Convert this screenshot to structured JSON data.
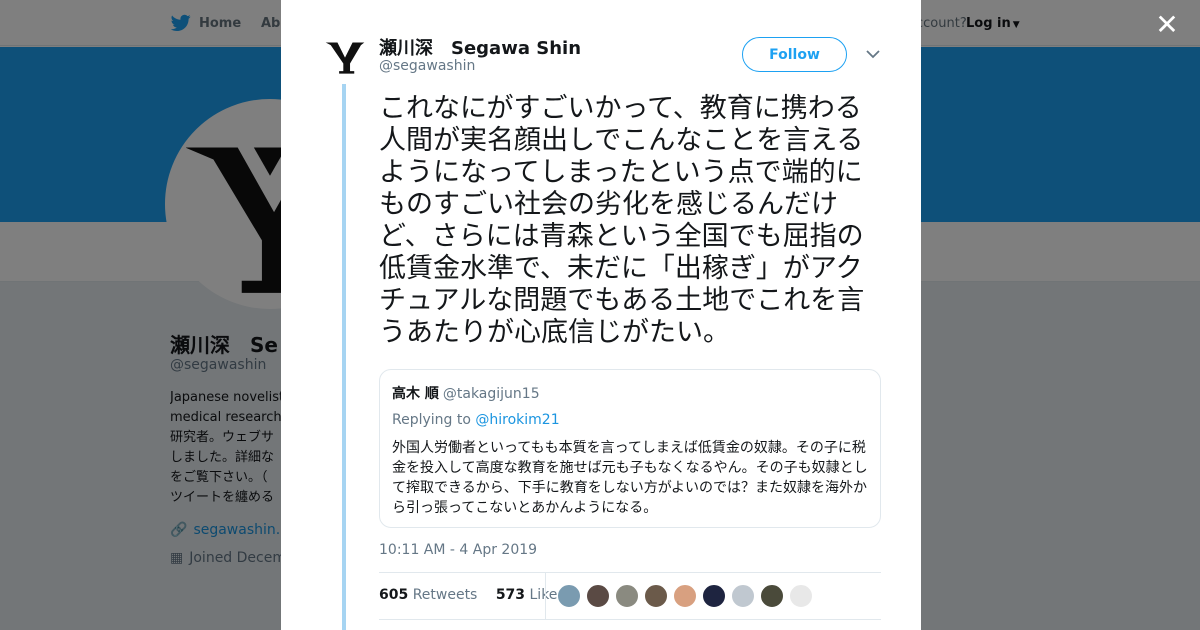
{
  "nav": {
    "home": "Home",
    "about": "Abo",
    "account_prompt": "ccount?",
    "login": "Log in"
  },
  "profile": {
    "name": "瀬川深　Se",
    "handle": "@segawashin",
    "bio": [
      "Japanese novelist",
      "medical researche",
      "研究者。ウェブサ",
      "しました。詳細な",
      "をご覧下さい。（",
      "ツイートを纏める"
    ],
    "link": "segawashin.co",
    "joined": "Joined Decem"
  },
  "tweet": {
    "author_name": "瀬川深　Segawa Shin",
    "author_handle": "@segawashin",
    "follow_label": "Follow",
    "text": "これなにがすごいかって、教育に携わる人間が実名顔出しでこんなことを言えるようになってしまったという点で端的にものすごい社会の劣化を感じるんだけど、さらには青森という全国でも屈指の低賃金水準で、未だに「出稼ぎ」がアクチュアルな問題でもある土地でこれを言うあたりが心底信じがたい。",
    "timestamp": "10:11 AM - 4 Apr 2019",
    "retweets": {
      "count": "605",
      "label": "Retweets"
    },
    "likes": {
      "count": "573",
      "label": "Likes"
    }
  },
  "quote": {
    "name": "高木 順",
    "handle": "@takagijun15",
    "replying_prefix": "Replying to",
    "replying_to": "@hirokim21",
    "text": "外国人労働者といってもも本質を言ってしまえば低賃金の奴隷。その子に税金を投入して高度な教育を施せば元も子もなくなるやん。その子も奴隷として搾取できるから、下手に教育をしない方がよいのでは？また奴隷を海外から引っ張ってこないとあかんようになる。"
  },
  "likers": [
    "#7a9bb0",
    "#5a4a44",
    "#8a8a80",
    "#6b5a4a",
    "#d8a080",
    "#1e2440",
    "#c0c8d0",
    "#4a4a3a",
    "#e8e8e8"
  ],
  "colors": {
    "brand": "#1da1f2",
    "link": "#1b95e0",
    "thread_line": "#a6d4f2"
  }
}
